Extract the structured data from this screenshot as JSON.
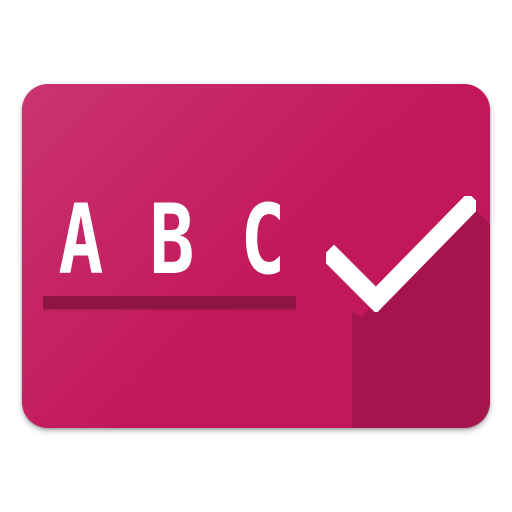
{
  "icon": {
    "text": "ABC",
    "letters": [
      "A",
      "B",
      "C"
    ],
    "symbol": "check-icon",
    "colors": {
      "card": "#c2185b",
      "underline": "#8e1442",
      "foreground": "#ffffff"
    }
  }
}
